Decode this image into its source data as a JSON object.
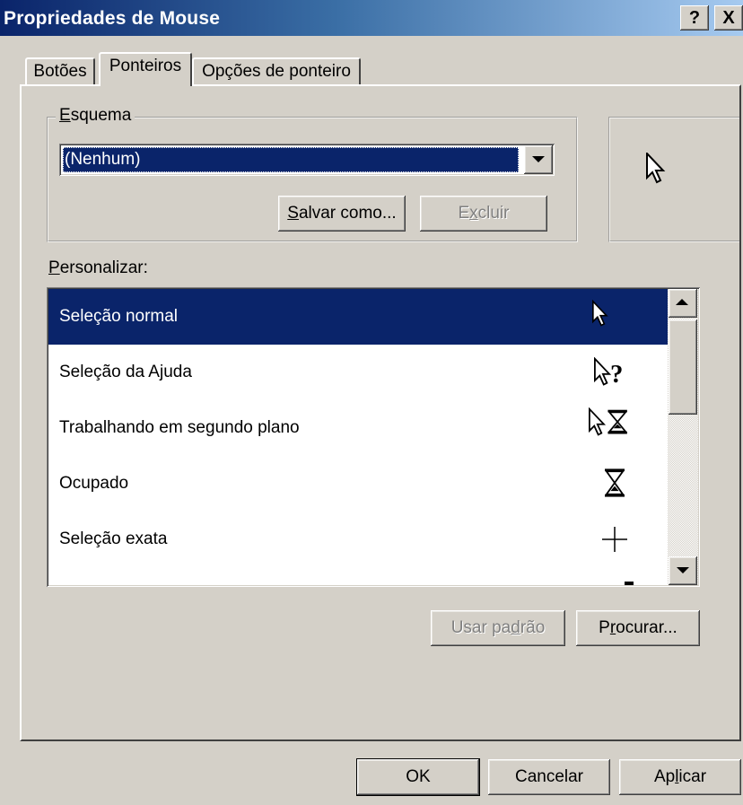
{
  "window": {
    "title": "Propriedades de Mouse",
    "help_button": "?",
    "close_button": "X"
  },
  "tabs": [
    {
      "label": "Botões",
      "active": false
    },
    {
      "label": "Ponteiros",
      "active": true
    },
    {
      "label": "Opções de ponteiro",
      "active": false
    }
  ],
  "scheme": {
    "group_label": "Esquema",
    "group_label_accel": "E",
    "group_label_rest": "squema",
    "selected_value": "(Nenhum)",
    "save_as_button": {
      "accel": "S",
      "rest": "alvar como..."
    },
    "delete_button": {
      "pre": "E",
      "accel": "x",
      "rest": "cluir",
      "enabled": false
    }
  },
  "customize": {
    "label_accel": "P",
    "label_rest": "ersonalizar:",
    "items": [
      {
        "label": "Seleção normal",
        "icon": "arrow-cursor-icon",
        "selected": true
      },
      {
        "label": "Seleção da Ajuda",
        "icon": "help-cursor-icon",
        "selected": false
      },
      {
        "label": "Trabalhando em segundo plano",
        "icon": "working-cursor-icon",
        "selected": false
      },
      {
        "label": "Ocupado",
        "icon": "hourglass-cursor-icon",
        "selected": false
      },
      {
        "label": "Seleção exata",
        "icon": "crosshair-cursor-icon",
        "selected": false
      }
    ]
  },
  "buttons": {
    "use_default": {
      "pre": "Usar pa",
      "accel": "d",
      "rest": "rão",
      "enabled": false
    },
    "browse": {
      "pre": "P",
      "accel": "r",
      "rest": "ocurar..."
    },
    "ok": "OK",
    "cancel": "Cancelar",
    "apply": {
      "pre": "Ap",
      "accel": "l",
      "rest": "icar"
    }
  },
  "colors": {
    "selection": "#0a246a",
    "face": "#d4d0c8",
    "title_gradient_start": "#0a246a",
    "title_gradient_end": "#a6caf0"
  }
}
